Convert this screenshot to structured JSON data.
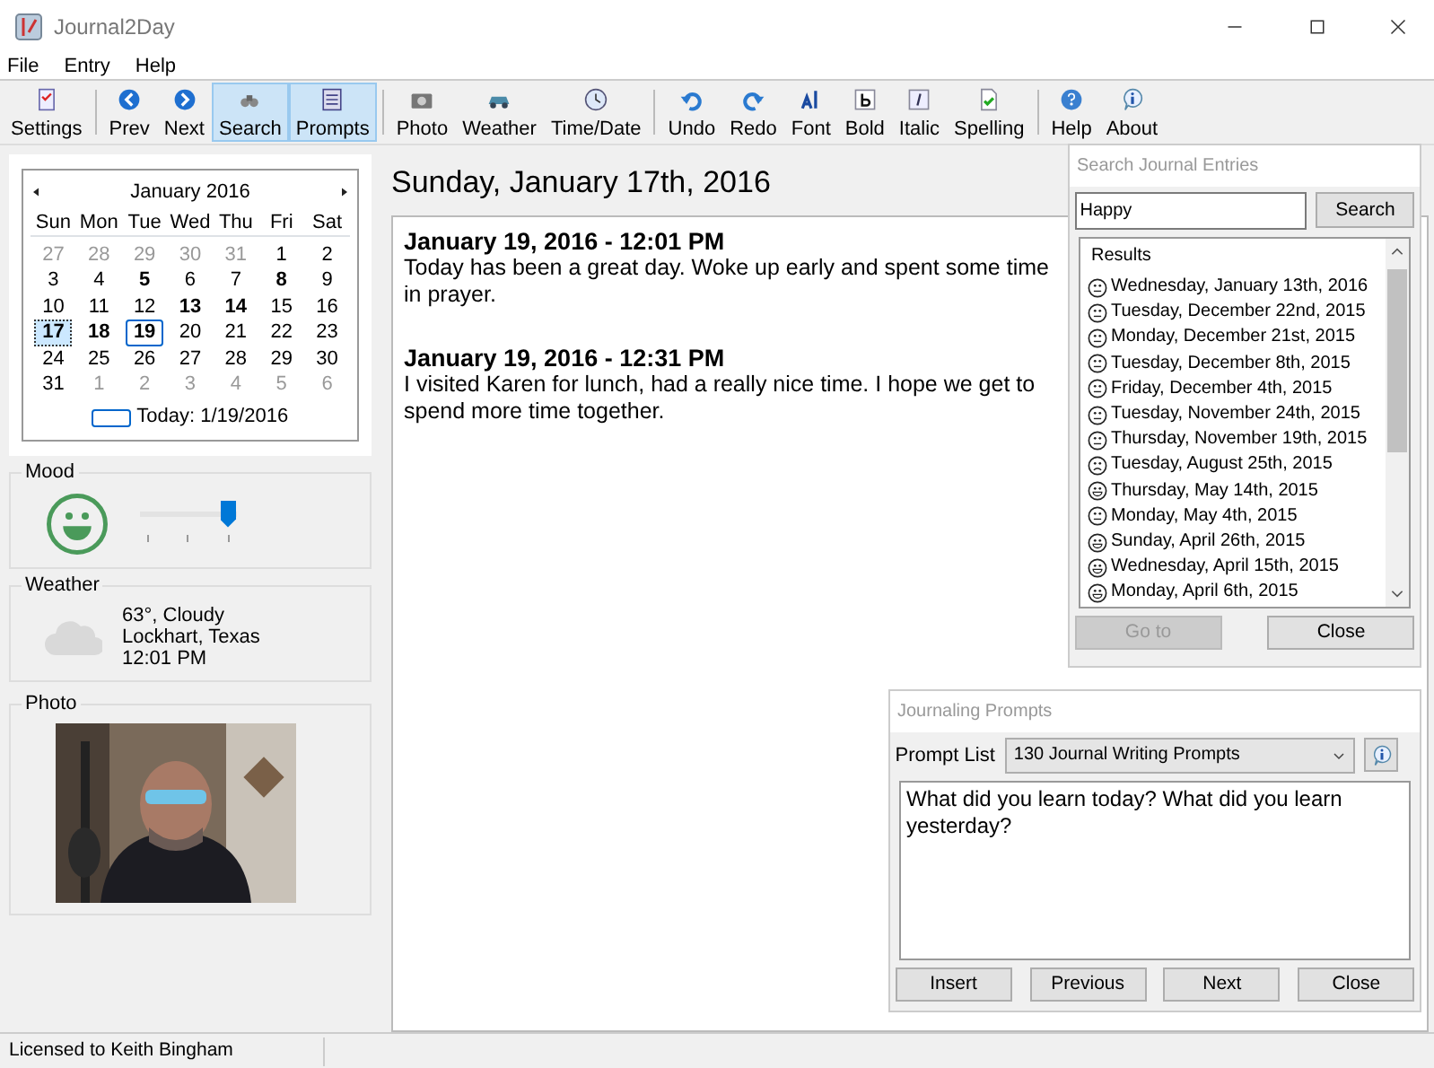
{
  "window": {
    "title": "Journal2Day"
  },
  "menu": [
    "File",
    "Entry",
    "Help"
  ],
  "toolbar": [
    [
      {
        "label": "Settings",
        "selected": false
      }
    ],
    [
      {
        "label": "Prev",
        "selected": false
      },
      {
        "label": "Next",
        "selected": false
      },
      {
        "label": "Search",
        "selected": true
      },
      {
        "label": "Prompts",
        "selected": true
      }
    ],
    [
      {
        "label": "Photo",
        "selected": false
      },
      {
        "label": "Weather",
        "selected": false
      },
      {
        "label": "Time/Date",
        "selected": false
      }
    ],
    [
      {
        "label": "Undo",
        "selected": false
      },
      {
        "label": "Redo",
        "selected": false
      },
      {
        "label": "Font",
        "selected": false
      },
      {
        "label": "Bold",
        "selected": false
      },
      {
        "label": "Italic",
        "selected": false
      },
      {
        "label": "Spelling",
        "selected": false
      }
    ],
    [
      {
        "label": "Help",
        "selected": false
      },
      {
        "label": "About",
        "selected": false
      }
    ]
  ],
  "calendar": {
    "month": "January 2016",
    "weekdays": [
      "Sun",
      "Mon",
      "Tue",
      "Wed",
      "Thu",
      "Fri",
      "Sat"
    ],
    "days": [
      {
        "text": "27",
        "muted": true,
        "bold": false,
        "selected": false,
        "today": false
      },
      {
        "text": "28",
        "muted": true,
        "bold": false,
        "selected": false,
        "today": false
      },
      {
        "text": "29",
        "muted": true,
        "bold": false,
        "selected": false,
        "today": false
      },
      {
        "text": "30",
        "muted": true,
        "bold": false,
        "selected": false,
        "today": false
      },
      {
        "text": "31",
        "muted": true,
        "bold": false,
        "selected": false,
        "today": false
      },
      {
        "text": "1",
        "muted": false,
        "bold": false,
        "selected": false,
        "today": false
      },
      {
        "text": "2",
        "muted": false,
        "bold": false,
        "selected": false,
        "today": false
      },
      {
        "text": "3",
        "muted": false,
        "bold": false,
        "selected": false,
        "today": false
      },
      {
        "text": "4",
        "muted": false,
        "bold": false,
        "selected": false,
        "today": false
      },
      {
        "text": "5",
        "muted": false,
        "bold": true,
        "selected": false,
        "today": false
      },
      {
        "text": "6",
        "muted": false,
        "bold": false,
        "selected": false,
        "today": false
      },
      {
        "text": "7",
        "muted": false,
        "bold": false,
        "selected": false,
        "today": false
      },
      {
        "text": "8",
        "muted": false,
        "bold": true,
        "selected": false,
        "today": false
      },
      {
        "text": "9",
        "muted": false,
        "bold": false,
        "selected": false,
        "today": false
      },
      {
        "text": "10",
        "muted": false,
        "bold": false,
        "selected": false,
        "today": false
      },
      {
        "text": "11",
        "muted": false,
        "bold": false,
        "selected": false,
        "today": false
      },
      {
        "text": "12",
        "muted": false,
        "bold": false,
        "selected": false,
        "today": false
      },
      {
        "text": "13",
        "muted": false,
        "bold": true,
        "selected": false,
        "today": false
      },
      {
        "text": "14",
        "muted": false,
        "bold": true,
        "selected": false,
        "today": false
      },
      {
        "text": "15",
        "muted": false,
        "bold": false,
        "selected": false,
        "today": false
      },
      {
        "text": "16",
        "muted": false,
        "bold": false,
        "selected": false,
        "today": false
      },
      {
        "text": "17",
        "muted": false,
        "bold": true,
        "selected": true,
        "today": false
      },
      {
        "text": "18",
        "muted": false,
        "bold": true,
        "selected": false,
        "today": false
      },
      {
        "text": "19",
        "muted": false,
        "bold": true,
        "selected": false,
        "today": true
      },
      {
        "text": "20",
        "muted": false,
        "bold": false,
        "selected": false,
        "today": false
      },
      {
        "text": "21",
        "muted": false,
        "bold": false,
        "selected": false,
        "today": false
      },
      {
        "text": "22",
        "muted": false,
        "bold": false,
        "selected": false,
        "today": false
      },
      {
        "text": "23",
        "muted": false,
        "bold": false,
        "selected": false,
        "today": false
      },
      {
        "text": "24",
        "muted": false,
        "bold": false,
        "selected": false,
        "today": false
      },
      {
        "text": "25",
        "muted": false,
        "bold": false,
        "selected": false,
        "today": false
      },
      {
        "text": "26",
        "muted": false,
        "bold": false,
        "selected": false,
        "today": false
      },
      {
        "text": "27",
        "muted": false,
        "bold": false,
        "selected": false,
        "today": false
      },
      {
        "text": "28",
        "muted": false,
        "bold": false,
        "selected": false,
        "today": false
      },
      {
        "text": "29",
        "muted": false,
        "bold": false,
        "selected": false,
        "today": false
      },
      {
        "text": "30",
        "muted": false,
        "bold": false,
        "selected": false,
        "today": false
      },
      {
        "text": "31",
        "muted": false,
        "bold": false,
        "selected": false,
        "today": false
      },
      {
        "text": "1",
        "muted": true,
        "bold": false,
        "selected": false,
        "today": false
      },
      {
        "text": "2",
        "muted": true,
        "bold": false,
        "selected": false,
        "today": false
      },
      {
        "text": "3",
        "muted": true,
        "bold": false,
        "selected": false,
        "today": false
      },
      {
        "text": "4",
        "muted": true,
        "bold": false,
        "selected": false,
        "today": false
      },
      {
        "text": "5",
        "muted": true,
        "bold": false,
        "selected": false,
        "today": false
      },
      {
        "text": "6",
        "muted": true,
        "bold": false,
        "selected": false,
        "today": false
      }
    ],
    "today_label": "Today: 1/19/2016"
  },
  "mood": {
    "title": "Mood",
    "level": 1.0
  },
  "weather": {
    "title": "Weather",
    "lines": [
      "63°, Cloudy",
      "Lockhart, Texas",
      "12:01 PM"
    ]
  },
  "photo": {
    "title": "Photo",
    "kind": "picture"
  },
  "editor": {
    "date_heading": "Sunday, January 17th, 2016",
    "entries": [
      {
        "heading": "January 19, 2016 - 12:01 PM",
        "body": "Today has been a great day. Woke up early and spent some time in prayer."
      },
      {
        "heading": "January 19, 2016 - 12:31 PM",
        "body": "I visited Karen for lunch, had a really nice time.  I hope we get to spend more time together."
      }
    ]
  },
  "search_panel": {
    "title": "Search Journal Entries",
    "query": "Happy",
    "search_button": "Search",
    "results_header": "Results",
    "results": [
      {
        "text": "Wednesday, January 13th, 2016",
        "kind": "neutral"
      },
      {
        "text": "Tuesday, December 22nd, 2015",
        "kind": "neutral"
      },
      {
        "text": "Monday, December 21st, 2015",
        "kind": "neutral"
      },
      {
        "text": "Tuesday, December 8th, 2015",
        "kind": "neutral"
      },
      {
        "text": "Friday, December 4th, 2015",
        "kind": "neutral"
      },
      {
        "text": "Tuesday, November 24th, 2015",
        "kind": "neutral"
      },
      {
        "text": "Thursday, November 19th, 2015",
        "kind": "neutral"
      },
      {
        "text": "Tuesday, August 25th, 2015",
        "kind": "sad"
      },
      {
        "text": "Thursday, May 14th, 2015",
        "kind": "happy"
      },
      {
        "text": "Monday, May 4th, 2015",
        "kind": "neutral"
      },
      {
        "text": "Sunday, April 26th, 2015",
        "kind": "happy"
      },
      {
        "text": "Wednesday, April 15th, 2015",
        "kind": "happy"
      },
      {
        "text": "Monday, April 6th, 2015",
        "kind": "happy"
      }
    ],
    "goto_button": {
      "label": "Go to",
      "disabled": true
    },
    "close_button": "Close"
  },
  "prompts_panel": {
    "title": "Journaling Prompts",
    "list_label": "Prompt List",
    "list_value": "130 Journal Writing Prompts",
    "prompt": "What did you learn today? What did you learn yesterday?",
    "buttons": [
      "Insert",
      "Previous",
      "Next",
      "Close"
    ]
  },
  "status_bar": {
    "text": "Licensed to Keith Bingham"
  }
}
